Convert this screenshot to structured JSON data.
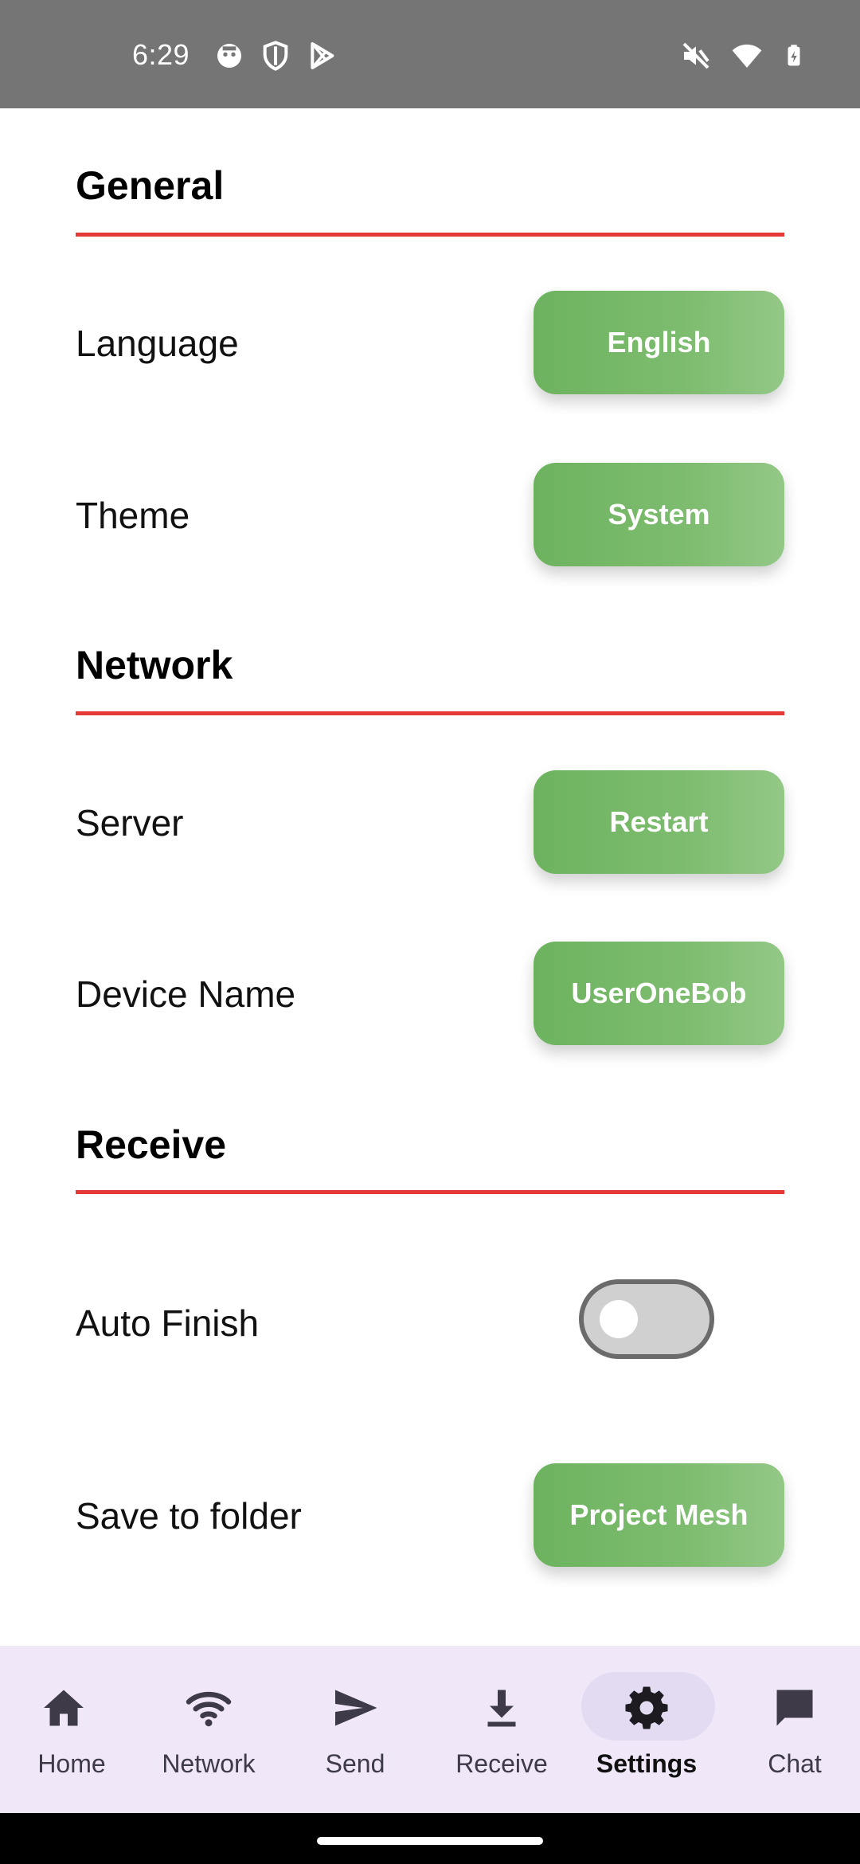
{
  "status_bar": {
    "time": "6:29"
  },
  "sections": {
    "general": {
      "title": "General",
      "language_label": "Language",
      "language_value": "English",
      "theme_label": "Theme",
      "theme_value": "System"
    },
    "network": {
      "title": "Network",
      "server_label": "Server",
      "server_action": "Restart",
      "device_name_label": "Device Name",
      "device_name_value": "UserOneBob"
    },
    "receive": {
      "title": "Receive",
      "auto_finish_label": "Auto Finish",
      "auto_finish_on": false,
      "save_folder_label": "Save to folder",
      "save_folder_value": "Project Mesh"
    }
  },
  "bottom_nav": {
    "items": [
      {
        "label": "Home",
        "icon": "home-icon"
      },
      {
        "label": "Network",
        "icon": "wifi-icon"
      },
      {
        "label": "Send",
        "icon": "send-icon"
      },
      {
        "label": "Receive",
        "icon": "download-icon"
      },
      {
        "label": "Settings",
        "icon": "gear-icon",
        "active": true
      },
      {
        "label": "Chat",
        "icon": "chat-icon"
      }
    ]
  },
  "colors": {
    "accent_red": "#e53935",
    "button_green": "#6db35f",
    "nav_background": "#f0e8f9"
  }
}
